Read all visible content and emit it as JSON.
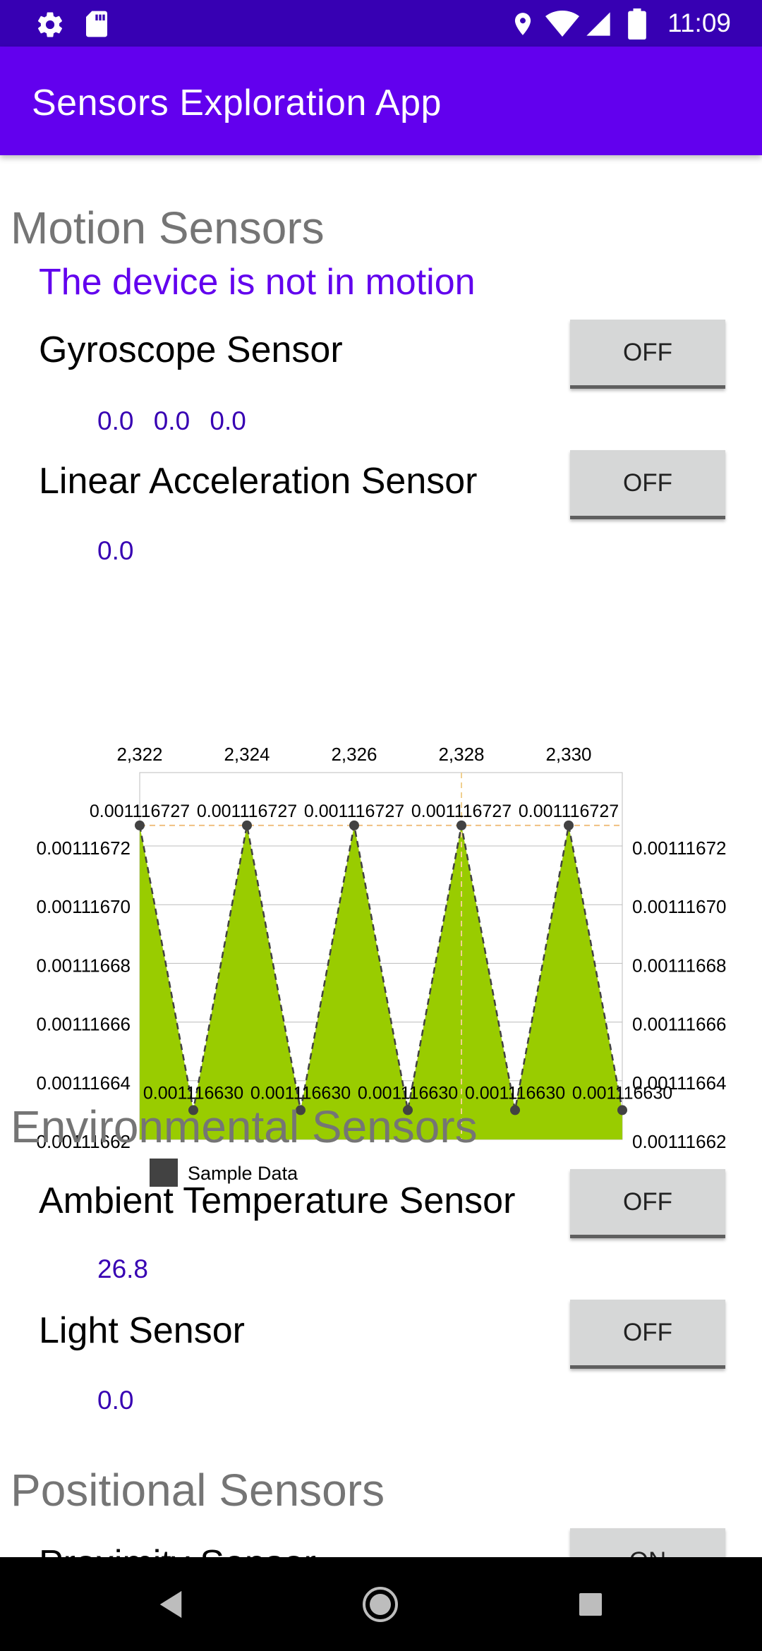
{
  "status_bar": {
    "time": "11:09",
    "left_icons": [
      "settings-icon",
      "sd-card-icon"
    ],
    "right_icons": [
      "location-icon",
      "wifi-icon",
      "signal-icon",
      "battery-icon"
    ]
  },
  "app_bar": {
    "title": "Sensors Exploration App"
  },
  "motion": {
    "title": "Motion Sensors",
    "status": "The device is not in motion",
    "gyroscope": {
      "label": "Gyroscope Sensor",
      "button": "OFF",
      "reading": "0.0  0.0  0.0"
    },
    "linear_acceleration": {
      "label": "Linear Acceleration Sensor",
      "button": "OFF",
      "reading": "0.0"
    }
  },
  "chart_data": {
    "type": "area",
    "x_ticks": [
      "2,322",
      "2,324",
      "2,326",
      "2,328",
      "2,330"
    ],
    "y_ticks": [
      "0.00111672",
      "0.00111670",
      "0.00111668",
      "0.00111666",
      "0.00111664",
      "0.00111662"
    ],
    "ylim": [
      0.00111662,
      0.001116745
    ],
    "xlim": [
      2322,
      2331
    ],
    "series": [
      {
        "name": "Sample Data",
        "color": "#99cc00",
        "points": [
          {
            "x": 2322,
            "y": 0.001116727,
            "label": "0.001116727"
          },
          {
            "x": 2323,
            "y": 0.00111663,
            "label": "0.001116630"
          },
          {
            "x": 2324,
            "y": 0.001116727,
            "label": "0.001116727"
          },
          {
            "x": 2325,
            "y": 0.00111663,
            "label": "0.001116630"
          },
          {
            "x": 2326,
            "y": 0.001116727,
            "label": "0.001116727"
          },
          {
            "x": 2327,
            "y": 0.00111663,
            "label": "0.001116630"
          },
          {
            "x": 2328,
            "y": 0.001116727,
            "label": "0.001116727"
          },
          {
            "x": 2329,
            "y": 0.00111663,
            "label": "0.001116630"
          },
          {
            "x": 2330,
            "y": 0.001116727,
            "label": "0.001116727"
          },
          {
            "x": 2331,
            "y": 0.00111663,
            "label": "0.001116630"
          }
        ]
      }
    ],
    "legend": "bottom-left",
    "grid": true
  },
  "environmental": {
    "title": "Environmental Sensors",
    "ambient_temperature": {
      "label": "Ambient Temperature Sensor",
      "button": "OFF",
      "reading": "26.8"
    },
    "light": {
      "label": "Light Sensor",
      "button": "OFF",
      "reading": "0.0"
    }
  },
  "positional": {
    "title": "Positional Sensors",
    "proximity": {
      "label": "Proximity Sensor",
      "button": "ON"
    }
  },
  "nav_bar": {
    "icons": [
      "back-icon",
      "home-icon",
      "recents-icon"
    ]
  }
}
